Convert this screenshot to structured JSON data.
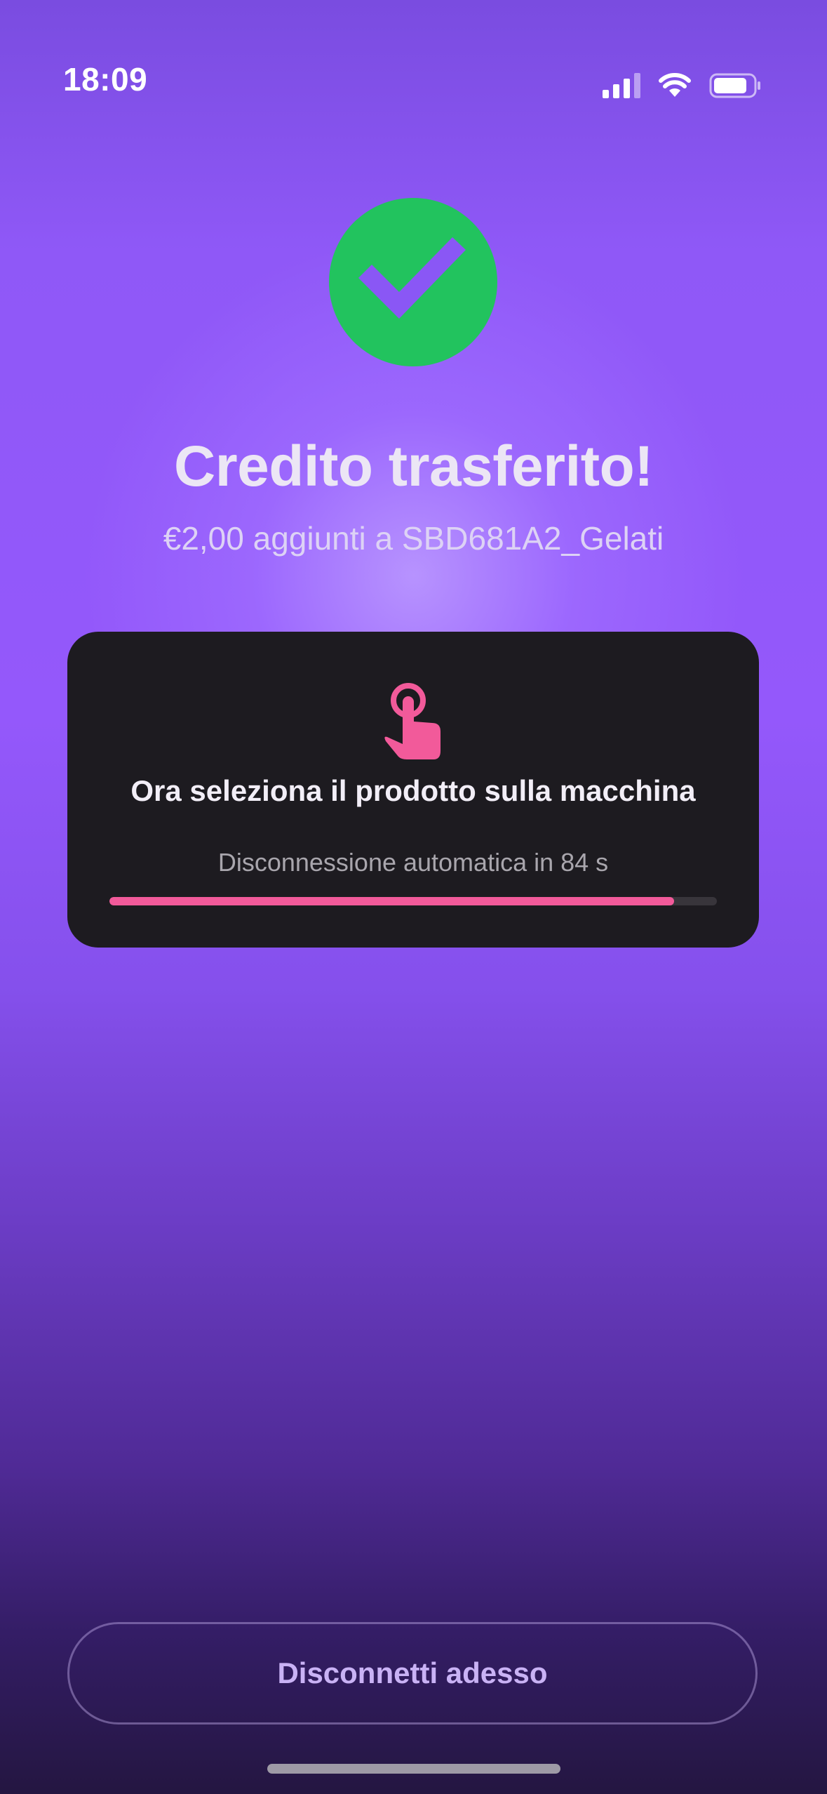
{
  "status_bar": {
    "time": "18:09",
    "icons": [
      "cellular-signal-icon",
      "wifi-icon",
      "battery-icon"
    ]
  },
  "success": {
    "icon": "checkmark-icon",
    "title": "Credito trasferito!",
    "subtitle": "€2,00 aggiunti a SBD681A2_Gelati"
  },
  "instruction_card": {
    "icon": "tap-hand-icon",
    "title": "Ora seleziona il prodotto sulla macchina",
    "countdown_text": "Disconnessione automatica in 84 s",
    "progress_percent": 93
  },
  "actions": {
    "disconnect_label": "Disconnetti adesso"
  },
  "colors": {
    "accent_green": "#22c35e",
    "accent_pink": "#f25a9a",
    "card_background": "#1d1b20",
    "background_purple": "#9458fb"
  }
}
